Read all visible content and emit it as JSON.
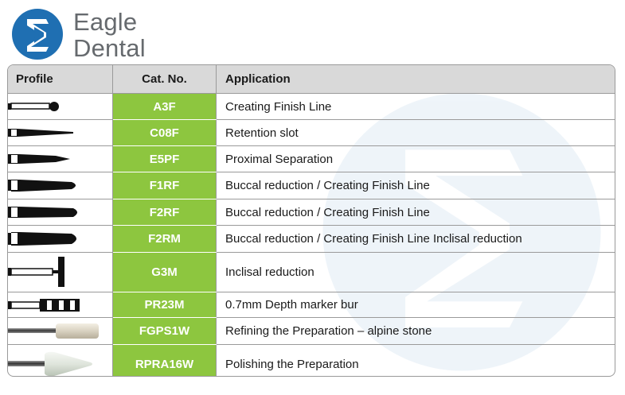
{
  "brand": {
    "name_line1": "Eagle",
    "name_line2": "Dental",
    "logo_color": "#1f6fb2"
  },
  "table": {
    "headers": {
      "profile": "Profile",
      "cat_no": "Cat. No.",
      "application": "Application"
    },
    "cat_color": "#8dc63f",
    "rows": [
      {
        "profile_icon": "chamfer-ball-end-bur-icon",
        "cat_no": "A3F",
        "application": "Creating Finish Line"
      },
      {
        "profile_icon": "thin-tapered-bur-icon",
        "cat_no": "C08F",
        "application": "Retention slot"
      },
      {
        "profile_icon": "pointed-tapered-bur-icon",
        "cat_no": "E5PF",
        "application": "Proximal Separation"
      },
      {
        "profile_icon": "long-round-end-bur-icon",
        "cat_no": "F1RF",
        "application": "Buccal reduction / Creating Finish Line"
      },
      {
        "profile_icon": "long-round-end-bur-icon",
        "cat_no": "F2RF",
        "application": "Buccal reduction / Creating Finish Line"
      },
      {
        "profile_icon": "long-round-end-bur-icon",
        "cat_no": "F2RM",
        "application": "Buccal reduction / Creating Finish Line Inclisal reduction"
      },
      {
        "profile_icon": "wheel-bur-icon",
        "cat_no": "G3M",
        "application": "Inclisal reduction"
      },
      {
        "profile_icon": "depth-marker-bur-icon",
        "cat_no": "PR23M",
        "application": "0.7mm Depth marker bur"
      },
      {
        "profile_icon": "alpine-stone-icon",
        "cat_no": "FGPS1W",
        "application": "Refining the Preparation – alpine stone"
      },
      {
        "profile_icon": "polishing-point-icon",
        "cat_no": "RPRA16W",
        "application": "Polishing the Preparation"
      }
    ]
  }
}
